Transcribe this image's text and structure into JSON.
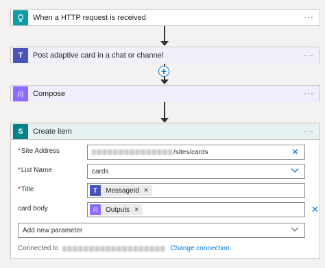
{
  "steps": [
    {
      "title": "When a HTTP request is received",
      "icon": "globe-icon",
      "color": "#0d9ba5"
    },
    {
      "title": "Post adaptive card in a chat or channel",
      "icon": "teams-icon",
      "color": "#4b53bc"
    },
    {
      "title": "Compose",
      "icon": "compose-icon",
      "color": "#8c6cff"
    },
    {
      "title": "Create item",
      "icon": "sharepoint-icon",
      "color": "#038387"
    }
  ],
  "create_item": {
    "fields": {
      "site_address": {
        "label": "Site Address",
        "value_suffix": "/sites/cards"
      },
      "list_name": {
        "label": "List Name",
        "value": "cards"
      },
      "title": {
        "label": "Title",
        "token": "MessageId"
      },
      "card_body": {
        "label": "card body",
        "token": "Outputs"
      }
    },
    "add_param_label": "Add new parameter",
    "connected_label": "Connected to",
    "change_connection_label": "Change connection."
  },
  "glyphs": {
    "more": "···",
    "close": "✕",
    "token_close": "×",
    "chevron": "⌵",
    "plus": "+",
    "required": "*"
  }
}
